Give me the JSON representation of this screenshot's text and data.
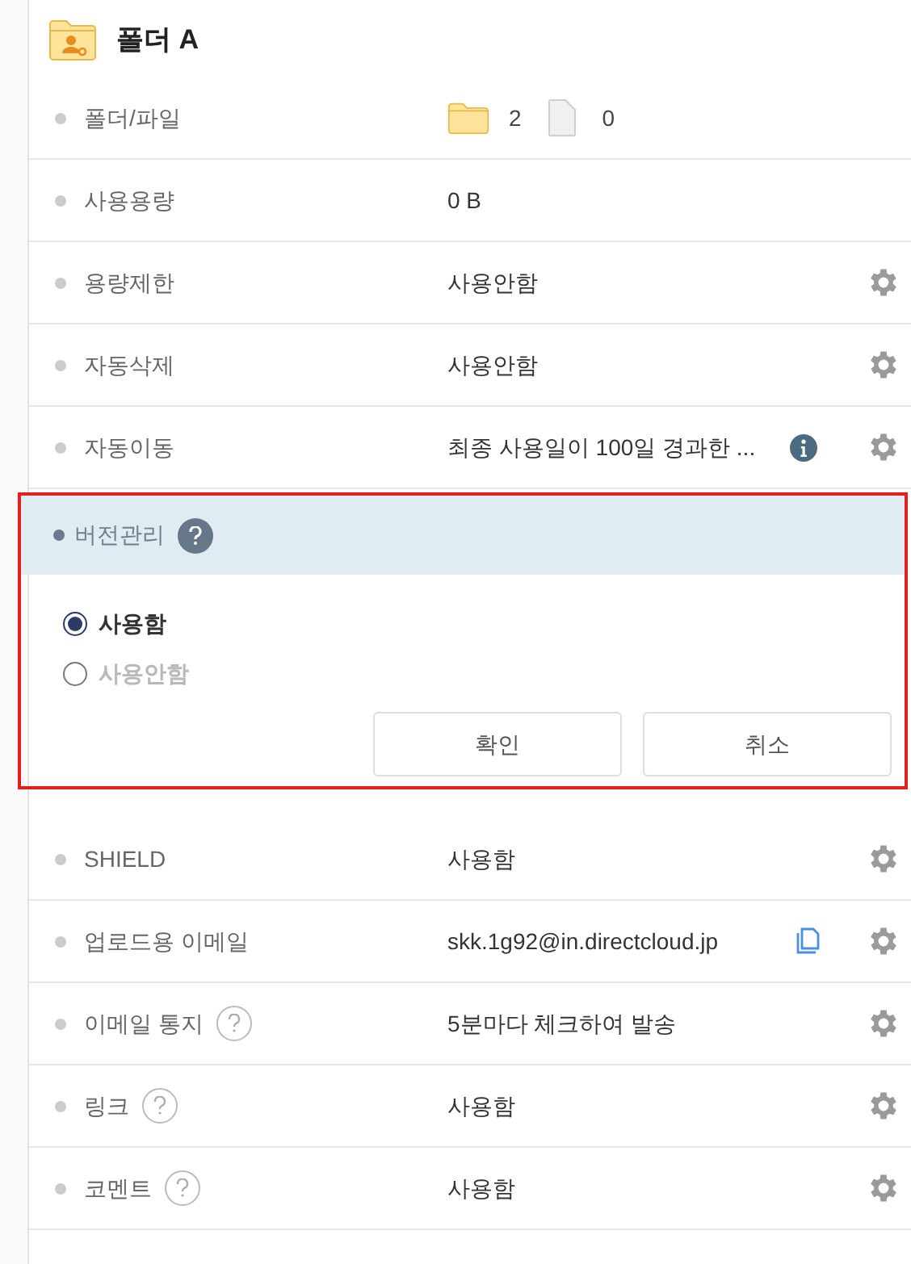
{
  "title": "폴더 A",
  "rows_before": [
    {
      "kind": "counts",
      "label": "폴더/파일",
      "help": false,
      "folders": "2",
      "files": "0"
    },
    {
      "kind": "text",
      "label": "사용용량",
      "help": false,
      "value": "0 B",
      "info": false,
      "copy": false,
      "settings": false
    },
    {
      "kind": "text",
      "label": "용량제한",
      "help": false,
      "value": "사용안함",
      "info": false,
      "copy": false,
      "settings": true
    },
    {
      "kind": "text",
      "label": "자동삭제",
      "help": false,
      "value": "사용안함",
      "info": false,
      "copy": false,
      "settings": true
    },
    {
      "kind": "text",
      "label": "자동이동",
      "help": false,
      "value": "최종 사용일이 100일 경과한 ...",
      "info": true,
      "copy": false,
      "settings": true
    }
  ],
  "version": {
    "label": "버전관리",
    "options": [
      {
        "label": "사용함",
        "selected": true
      },
      {
        "label": "사용안함",
        "selected": false
      }
    ],
    "buttons": [
      "확인",
      "취소"
    ]
  },
  "rows_after": [
    {
      "kind": "text",
      "label": "SHIELD",
      "help": false,
      "value": "사용함",
      "info": false,
      "copy": false,
      "settings": true
    },
    {
      "kind": "text",
      "label": "업로드용 이메일",
      "help": false,
      "value": "skk.1g92@in.directcloud.jp",
      "info": false,
      "copy": true,
      "settings": true
    },
    {
      "kind": "text",
      "label": "이메일 통지",
      "help": true,
      "value": "5분마다 체크하여 발송",
      "info": false,
      "copy": false,
      "settings": true
    },
    {
      "kind": "text",
      "label": "링크",
      "help": true,
      "value": "사용함",
      "info": false,
      "copy": false,
      "settings": true
    },
    {
      "kind": "text",
      "label": "코멘트",
      "help": true,
      "value": "사용함",
      "info": false,
      "copy": false,
      "settings": true
    }
  ]
}
